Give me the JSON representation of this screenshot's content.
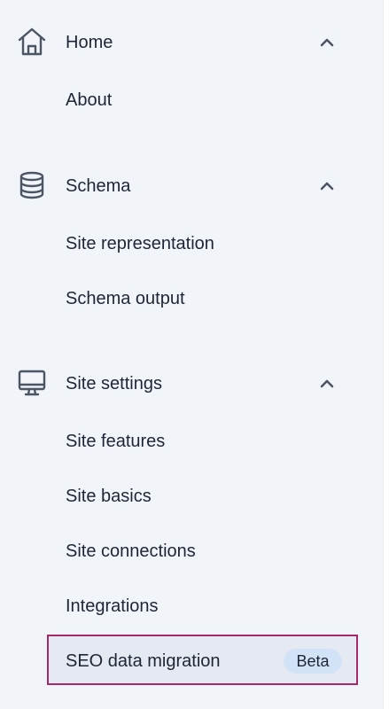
{
  "sidebar": {
    "sections": [
      {
        "title": "Home",
        "icon": "home-icon",
        "expanded": true,
        "items": [
          "About"
        ]
      },
      {
        "title": "Schema",
        "icon": "database-icon",
        "expanded": true,
        "items": [
          "Site representation",
          "Schema output"
        ]
      },
      {
        "title": "Site settings",
        "icon": "desktop-icon",
        "expanded": true,
        "items": [
          "Site features",
          "Site basics",
          "Site connections",
          "Integrations"
        ],
        "active_item": {
          "label": "SEO data migration",
          "badge": "Beta"
        }
      }
    ]
  },
  "colors": {
    "background": "#f1f4f9",
    "text": "#1e2635",
    "icon": "#4b5563",
    "active_border": "#a4286a",
    "active_background": "#e5e9f1",
    "badge_background": "#d3e3f7"
  }
}
